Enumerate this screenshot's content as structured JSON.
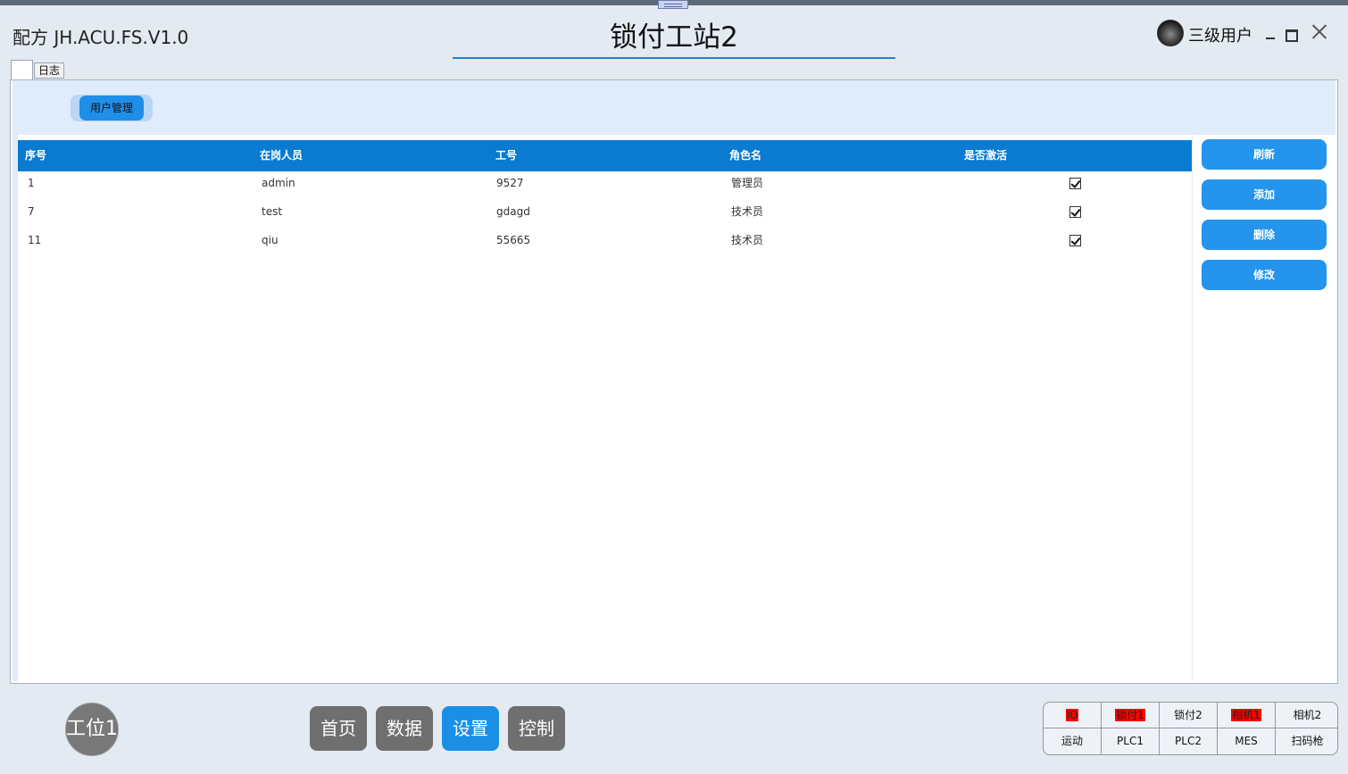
{
  "window": {
    "app_title": "配方 JH.ACU.FS.V1.0",
    "station_title": "锁付工站2",
    "user_level": "三级用户"
  },
  "tabs": {
    "log_label": "日志"
  },
  "subnav": {
    "user_management_label": "用户管理"
  },
  "table": {
    "headers": [
      "序号",
      "在岗人员",
      "工号",
      "角色名",
      "是否激活"
    ],
    "rows": [
      {
        "index": "1",
        "name": "admin",
        "employee_id": "9527",
        "role": "管理员",
        "active": true
      },
      {
        "index": "7",
        "name": "test",
        "employee_id": "gdagd",
        "role": "技术员",
        "active": true
      },
      {
        "index": "11",
        "name": "qiu",
        "employee_id": "55665",
        "role": "技术员",
        "active": true
      }
    ]
  },
  "actions": {
    "refresh": "刷新",
    "add": "添加",
    "delete": "删除",
    "modify": "修改"
  },
  "footer": {
    "station": "工位1",
    "nav": [
      "首页",
      "数据",
      "设置",
      "控制"
    ],
    "active_nav": "设置",
    "status_top": [
      {
        "label": "IO",
        "alarm": true
      },
      {
        "label": "锁付1",
        "alarm": true
      },
      {
        "label": "锁付2",
        "alarm": false
      },
      {
        "label": "相机1",
        "alarm": true
      },
      {
        "label": "相机2",
        "alarm": false
      }
    ],
    "status_bottom": [
      "运动",
      "PLC1",
      "PLC2",
      "MES",
      "扫码枪"
    ]
  },
  "colors": {
    "header_blue": "#0a7bd0",
    "button_blue": "#2494ec",
    "nav_gray": "#6f6f6f",
    "nav_active": "#1a8fe6",
    "alarm_red": "#ff0000"
  },
  "icons": {
    "avatar": "user-avatar",
    "minimize": "minimize-icon",
    "maximize": "maximize-icon",
    "close": "close-icon",
    "checkbox": "checkbox-checked-icon"
  }
}
